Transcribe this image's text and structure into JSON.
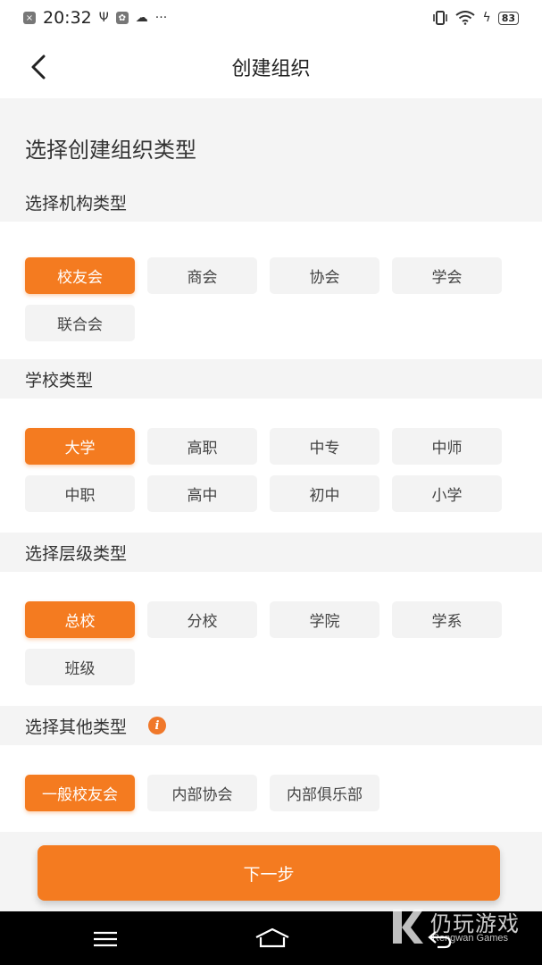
{
  "status_bar": {
    "time": "20:32",
    "left_icons": [
      "close-box-icon",
      "usb-icon",
      "app-icon",
      "cloud-icon"
    ],
    "more": "···",
    "right_icons": [
      "vibrate-icon",
      "wifi-icon",
      "charging-icon"
    ],
    "battery": "83"
  },
  "header": {
    "title": "创建组织",
    "back_icon": "chevron-left-icon"
  },
  "page": {
    "heading": "选择创建组织类型"
  },
  "sections": {
    "org_type": {
      "title": "选择机构类型",
      "options": [
        "校友会",
        "商会",
        "协会",
        "学会",
        "联合会"
      ],
      "selected": "校友会"
    },
    "school_type": {
      "title": "学校类型",
      "options": [
        "大学",
        "高职",
        "中专",
        "中师",
        "中职",
        "高中",
        "初中",
        "小学"
      ],
      "selected": "大学"
    },
    "level_type": {
      "title": "选择层级类型",
      "options": [
        "总校",
        "分校",
        "学院",
        "学系",
        "班级"
      ],
      "selected": "总校"
    },
    "other_type": {
      "title": "选择其他类型",
      "info_icon": "info-icon",
      "options": [
        "一般校友会",
        "内部协会",
        "内部俱乐部"
      ],
      "selected": "一般校友会"
    }
  },
  "footer": {
    "next_label": "下一步"
  },
  "nav_bar": {
    "icons": [
      "menu-icon",
      "home-icon",
      "back-icon"
    ]
  },
  "watermark": {
    "cn": "仍玩游戏",
    "en": "Rengwan Games"
  },
  "colors": {
    "accent": "#f47b20",
    "chip_bg": "#f3f3f3",
    "page_bg": "#f4f4f4"
  }
}
